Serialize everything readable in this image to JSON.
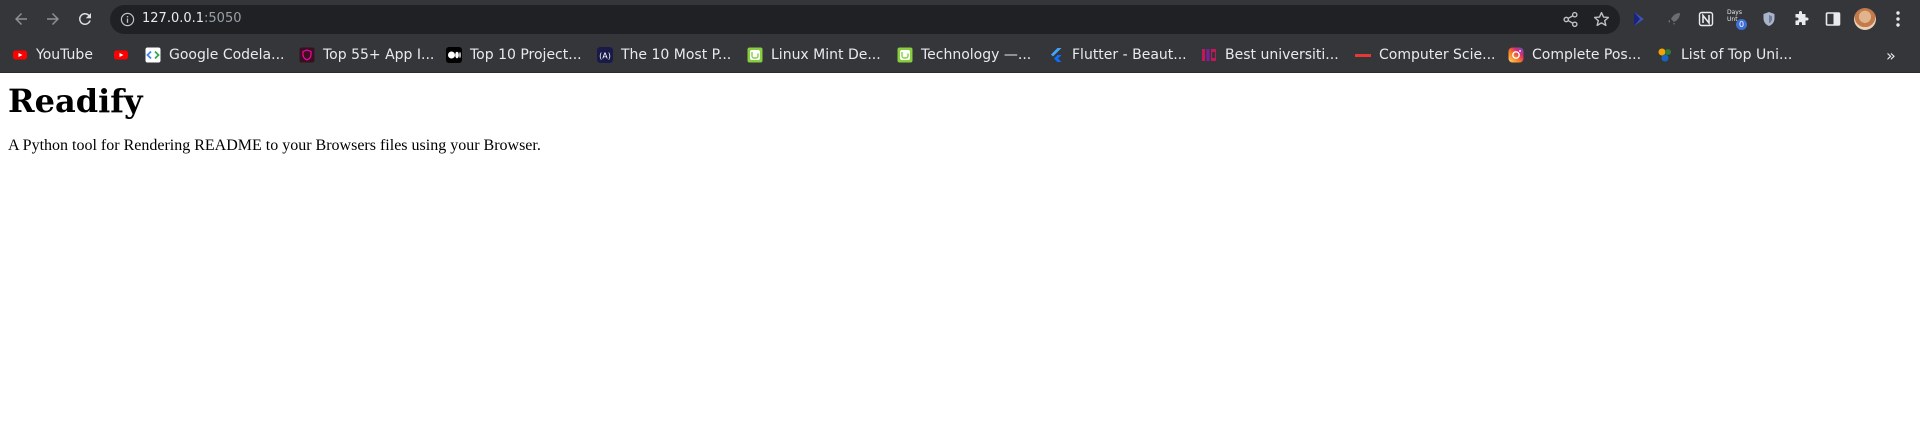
{
  "browser": {
    "url_host": "127.0.0.1",
    "url_port": ":5050",
    "toolbar_icons": [
      "back-icon",
      "forward-icon",
      "reload-icon",
      "info-icon",
      "share-icon",
      "star-icon"
    ],
    "extensions": [
      {
        "name": "cursor-extension-icon",
        "color": "#3f51b5"
      },
      {
        "name": "rocket-extension-icon",
        "color": "#6a6d72"
      },
      {
        "name": "notion-extension-icon",
        "color": "#e8eaed"
      },
      {
        "name": "days-until-extension-icon",
        "label_line1": "Days",
        "label_line2": "Unt",
        "count": "0"
      },
      {
        "name": "shield-extension-icon",
        "color": "#aab4c8"
      },
      {
        "name": "puzzle-icon",
        "color": "#e8eaed"
      },
      {
        "name": "side-panel-icon",
        "color": "#e8eaed"
      }
    ]
  },
  "bookmarks": [
    {
      "label": "YouTube",
      "icon": "youtube-icon",
      "color": "#ff0000"
    },
    {
      "label": "",
      "icon": "youtube-icon",
      "color": "#ff0000"
    },
    {
      "label": "Google Codela...",
      "icon": "google-codelabs-icon",
      "color": "#ffffff"
    },
    {
      "label": "Top 55+ App I...",
      "icon": "shield-badge-icon",
      "color": "#6b1f3a"
    },
    {
      "label": "Top 10 Project...",
      "icon": "medium-icon",
      "color": "#000000"
    },
    {
      "label": "The 10 Most P...",
      "icon": "angular-icon",
      "color": "#1a1a4a"
    },
    {
      "label": "Linux Mint De...",
      "icon": "linux-mint-icon",
      "color": "#87cf3e"
    },
    {
      "label": "Technology —...",
      "icon": "linux-mint-icon",
      "color": "#87cf3e"
    },
    {
      "label": "Flutter - Beaut...",
      "icon": "flutter-icon",
      "color": "#42a5f5"
    },
    {
      "label": "Best universiti...",
      "icon": "the-icon",
      "color": "#c2185b"
    },
    {
      "label": "Computer Scie...",
      "icon": "dash-icon",
      "color": "#e53935"
    },
    {
      "label": "Complete Pos...",
      "icon": "instagram-icon",
      "color": "#e1306c"
    },
    {
      "label": "List of Top Uni...",
      "icon": "colorful-icon",
      "color": "#f4a300"
    }
  ],
  "page": {
    "title": "Readify",
    "description": "A Python tool for Rendering README to your Browsers files using your Browser."
  }
}
